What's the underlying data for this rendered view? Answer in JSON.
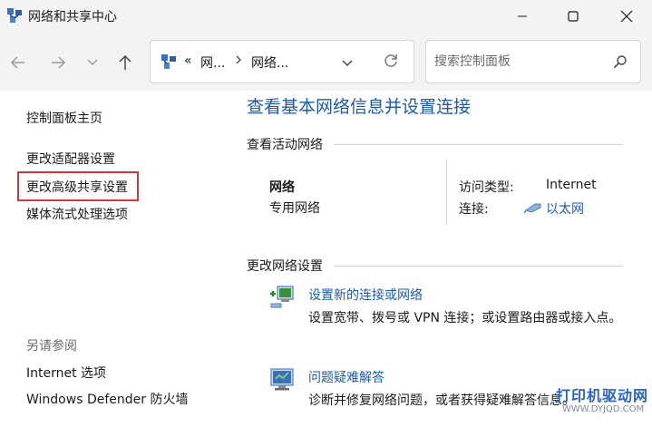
{
  "window": {
    "title": "网络和共享中心"
  },
  "address_bar": {
    "overflow": "«",
    "crumbs": [
      "网...",
      "网络..."
    ]
  },
  "search": {
    "placeholder": "搜索控制面板"
  },
  "sidebar": {
    "items": [
      "控制面板主页",
      "更改适配器设置",
      "更改高级共享设置",
      "媒体流式处理选项"
    ],
    "see_also_title": "另请参阅",
    "see_also": [
      "Internet 选项",
      "Windows Defender 防火墙"
    ]
  },
  "main": {
    "title": "查看基本网络信息并设置连接",
    "active_networks_title": "查看活动网络",
    "network_name": "网络",
    "network_category": "专用网络",
    "access_type_label": "访问类型:",
    "access_type_value": "Internet",
    "connections_label": "连接:",
    "connection_value": "以太网",
    "change_settings_title": "更改网络设置",
    "tasks": [
      {
        "title": "设置新的连接或网络",
        "description": "设置宽带、拨号或 VPN 连接；或设置路由器或接入点。"
      },
      {
        "title": "问题疑难解答",
        "description": "诊断并修复网络问题，或者获得疑难解答信息。"
      }
    ]
  },
  "watermark": {
    "main": "打印机驱动网",
    "sub": "WWW.DYJQD.COM"
  },
  "colors": {
    "link": "#1e5aa8",
    "highlight": "#d0393a",
    "chrome": "#f3f3f3"
  }
}
